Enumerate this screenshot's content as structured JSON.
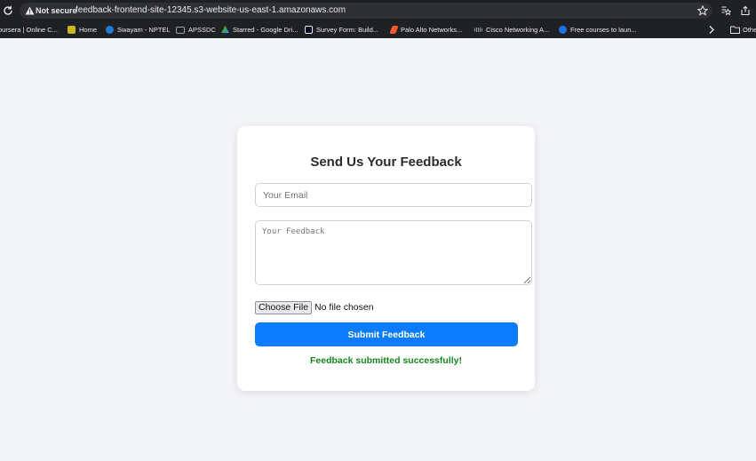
{
  "browser": {
    "security_label": "Not secure",
    "url": "feedback-frontend-site-12345.s3-website-us-east-1.amazonaws.com",
    "bookmarks": [
      {
        "label": "oursera | Online C...",
        "icon": "coursera-icon",
        "color": "#2a73cc"
      },
      {
        "label": "Home",
        "icon": "home-icon",
        "color": "#c9b81c"
      },
      {
        "label": "Swayam - NPTEL",
        "icon": "swayam-icon",
        "color": "#1f7bd1"
      },
      {
        "label": "APSSDC",
        "icon": "folder-icon",
        "color": "#9aa0a6"
      },
      {
        "label": "Starred - Google Dri...",
        "icon": "google-drive-icon",
        "color": "#34a853"
      },
      {
        "label": "Survey Form: Build...",
        "icon": "freecodecamp-icon",
        "color": "#ffffff"
      },
      {
        "label": "Palo Alto Networks...",
        "icon": "palo-alto-icon",
        "color": "#fa582d"
      },
      {
        "label": "Cisco Networking A...",
        "icon": "cisco-icon",
        "color": "#5f6368"
      },
      {
        "label": "Free courses to laun...",
        "icon": "c-logo-icon",
        "color": "#1a73e8"
      }
    ],
    "other_bookmarks": "Othe"
  },
  "form": {
    "title": "Send Us Your Feedback",
    "email_placeholder": "Your Email",
    "feedback_placeholder": "Your Feedback",
    "file_button": "Choose File",
    "file_status": "No file chosen",
    "submit_label": "Submit Feedback",
    "success_message": "Feedback submitted successfully!"
  },
  "colors": {
    "accent": "#0b7cff",
    "success": "#16851f",
    "page_background": "#f3f4f8"
  }
}
